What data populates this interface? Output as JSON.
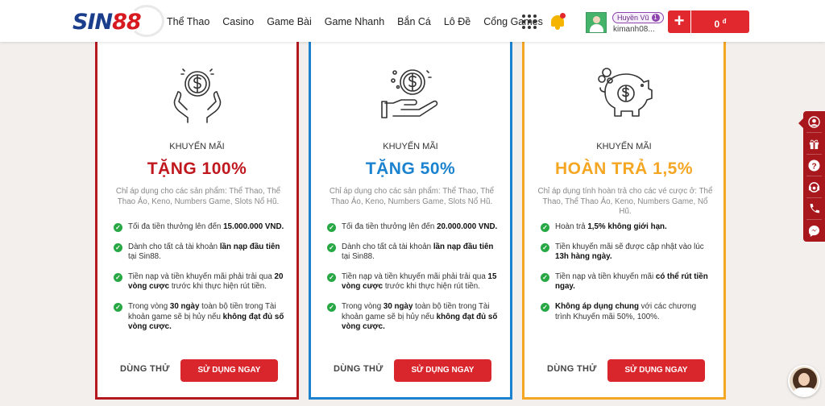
{
  "header": {
    "logo_main": "SIN",
    "logo_accent": "88",
    "nav": [
      "Thể Thao",
      "Casino",
      "Game Bài",
      "Game Nhanh",
      "Bắn Cá",
      "Lô Đề",
      "Cổng Games"
    ],
    "user": {
      "display_name": "Huyền Vũ",
      "vip_level": "1",
      "username": "kimanh08..."
    },
    "deposit_label": "+",
    "balance": "0",
    "currency": "đ"
  },
  "cards": [
    {
      "subtitle": "KHUYẾN MÃI",
      "title": "TẶNG 100%",
      "description": "Chỉ áp dụng cho các sản phẩm: Thể Thao, Thể Thao Ảo, Keno, Numbers Game, Slots Nổ Hũ.",
      "points": [
        [
          "Tối đa tiền thưởng lên đến ",
          "15.000.000 VND.",
          ""
        ],
        [
          "Dành cho tất cả tài khoản ",
          "lần nạp đầu tiên",
          " tại Sin88."
        ],
        [
          "Tiền nạp và tiền khuyến mãi phải trải qua ",
          "20 vòng cược",
          " trước khi thực hiện rút tiền."
        ],
        [
          "Trong vòng ",
          "30 ngày",
          " toàn bộ tiền trong Tài khoản game sẽ bị hủy nếu ",
          "không đạt đủ số vòng cược."
        ]
      ],
      "try_label": "DÙNG THỬ",
      "use_label": "SỬ DỤNG NGAY",
      "accent": "#b4191f"
    },
    {
      "subtitle": "KHUYẾN MÃI",
      "title": "TẶNG 50%",
      "description": "Chỉ áp dụng cho các sản phẩm: Thể Thao, Thể Thao Ảo, Keno, Numbers Game, Slots Nổ Hũ.",
      "points": [
        [
          "Tối đa tiền thưởng lên đến ",
          "20.000.000 VND.",
          ""
        ],
        [
          "Dành cho tất cả tài khoản ",
          "lần nạp đầu tiên",
          " tại Sin88."
        ],
        [
          "Tiền nạp và tiền khuyến mãi phải trải qua ",
          "15 vòng cược",
          " trước khi thực hiện rút tiền."
        ],
        [
          "Trong vòng ",
          "30 ngày",
          " toàn bộ tiền trong Tài khoản game sẽ bị hủy nếu ",
          "không đạt đủ số vòng cược."
        ]
      ],
      "try_label": "DÙNG THỬ",
      "use_label": "SỬ DỤNG NGAY",
      "accent": "#1b82cf"
    },
    {
      "subtitle": "KHUYẾN MÃI",
      "title": "HOÀN TRẢ 1,5%",
      "description": "Chỉ áp dụng tính hoàn trả cho các vé cược ở: Thể Thao, Thể Thao Ảo, Keno, Numbers Game, Nổ Hũ.",
      "points": [
        [
          "Hoàn trả ",
          "1,5% không giới hạn.",
          ""
        ],
        [
          "Tiền khuyến mãi sẽ được cập nhật vào lúc ",
          "13h hàng ngày.",
          ""
        ],
        [
          "Tiền nạp và tiền khuyến mãi ",
          "có thể rút tiền ngay.",
          ""
        ],
        [
          "",
          "Không áp dụng chung",
          " với các chương trình Khuyến mãi 50%, 100%."
        ]
      ],
      "try_label": "DÙNG THỬ",
      "use_label": "SỬ DỤNG NGAY",
      "accent": "#f5a623"
    }
  ],
  "sidebar_icons": [
    "user-icon",
    "gift-icon",
    "help-icon",
    "support-icon",
    "phone-icon",
    "messenger-icon"
  ]
}
